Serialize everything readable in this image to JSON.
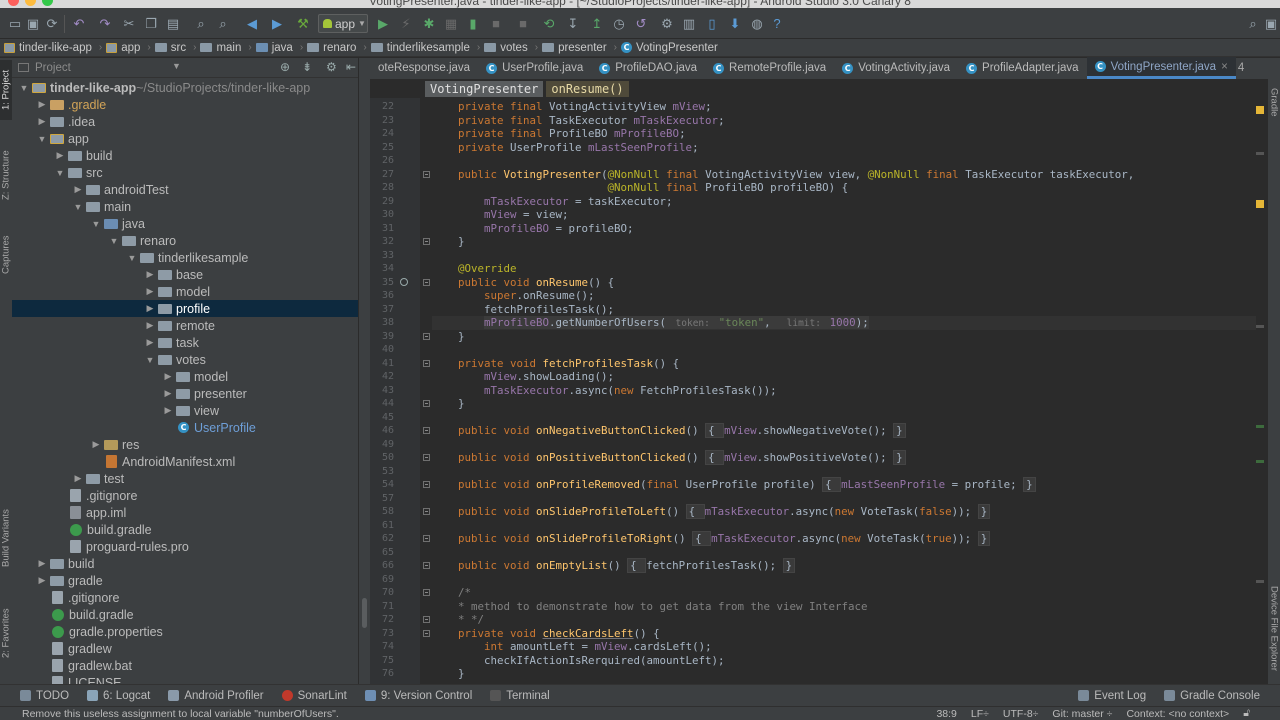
{
  "window": {
    "title": "VotingPresenter.java - tinder-like-app - [~/StudioProjects/tinder-like-app] - Android Studio 3.0 Canary 8"
  },
  "toolbar": {
    "run_config": "app"
  },
  "navbar": {
    "crumbs": [
      "tinder-like-app",
      "app",
      "src",
      "main",
      "java",
      "renaro",
      "tinderlikesample",
      "votes",
      "presenter",
      "VotingPresenter"
    ]
  },
  "left_strip": {
    "tabs": [
      "1: Project",
      "Z: Structure",
      "Captures",
      "Build Variants",
      "2: Favorites"
    ]
  },
  "right_strip": {
    "tabs": [
      "Gradle",
      "Device File Explorer"
    ]
  },
  "project": {
    "title": "Project",
    "tree": [
      {
        "label": "tinder-like-app",
        "extra": "~/StudioProjects/tinder-like-app",
        "depth": 0,
        "arrow": "down",
        "icon": "mod"
      },
      {
        "label": ".gradle",
        "depth": 1,
        "arrow": "right",
        "icon": "excluded"
      },
      {
        "label": ".idea",
        "depth": 1,
        "arrow": "right",
        "icon": "gray"
      },
      {
        "label": "app",
        "depth": 1,
        "arrow": "down",
        "icon": "mod"
      },
      {
        "label": "build",
        "depth": 2,
        "arrow": "right",
        "icon": "gray"
      },
      {
        "label": "src",
        "depth": 2,
        "arrow": "down",
        "icon": "gray"
      },
      {
        "label": "androidTest",
        "depth": 3,
        "arrow": "right",
        "icon": "gray"
      },
      {
        "label": "main",
        "depth": 3,
        "arrow": "down",
        "icon": "gray"
      },
      {
        "label": "java",
        "depth": 4,
        "arrow": "down",
        "icon": "blue"
      },
      {
        "label": "renaro",
        "depth": 5,
        "arrow": "down",
        "icon": "pkg"
      },
      {
        "label": "tinderlikesample",
        "depth": 6,
        "arrow": "down",
        "icon": "pkg"
      },
      {
        "label": "base",
        "depth": 7,
        "arrow": "right",
        "icon": "pkg"
      },
      {
        "label": "model",
        "depth": 7,
        "arrow": "right",
        "icon": "pkg"
      },
      {
        "label": "profile",
        "depth": 7,
        "arrow": "right",
        "icon": "pkg",
        "selected": true
      },
      {
        "label": "remote",
        "depth": 7,
        "arrow": "right",
        "icon": "pkg"
      },
      {
        "label": "task",
        "depth": 7,
        "arrow": "right",
        "icon": "pkg"
      },
      {
        "label": "votes",
        "depth": 7,
        "arrow": "down",
        "icon": "pkg"
      },
      {
        "label": "model",
        "depth": 8,
        "arrow": "right",
        "icon": "pkg"
      },
      {
        "label": "presenter",
        "depth": 8,
        "arrow": "right",
        "icon": "pkg"
      },
      {
        "label": "view",
        "depth": 8,
        "arrow": "right",
        "icon": "pkg"
      },
      {
        "label": "UserProfile",
        "depth": 8,
        "arrow": "",
        "icon": "class",
        "color": "#6e9fd8"
      },
      {
        "label": "res",
        "depth": 4,
        "arrow": "right",
        "icon": "res"
      },
      {
        "label": "AndroidManifest.xml",
        "depth": 4,
        "arrow": "",
        "icon": "xml"
      },
      {
        "label": "test",
        "depth": 3,
        "arrow": "right",
        "icon": "gray"
      },
      {
        "label": ".gitignore",
        "depth": 2,
        "arrow": "",
        "icon": "doc"
      },
      {
        "label": "app.iml",
        "depth": 2,
        "arrow": "",
        "icon": "iml"
      },
      {
        "label": "build.gradle",
        "depth": 2,
        "arrow": "",
        "icon": "gradle"
      },
      {
        "label": "proguard-rules.pro",
        "depth": 2,
        "arrow": "",
        "icon": "doc"
      },
      {
        "label": "build",
        "depth": 1,
        "arrow": "right",
        "icon": "gray"
      },
      {
        "label": "gradle",
        "depth": 1,
        "arrow": "right",
        "icon": "gray"
      },
      {
        "label": ".gitignore",
        "depth": 1,
        "arrow": "",
        "icon": "doc"
      },
      {
        "label": "build.gradle",
        "depth": 1,
        "arrow": "",
        "icon": "gradle"
      },
      {
        "label": "gradle.properties",
        "depth": 1,
        "arrow": "",
        "icon": "gradle"
      },
      {
        "label": "gradlew",
        "depth": 1,
        "arrow": "",
        "icon": "doc"
      },
      {
        "label": "gradlew.bat",
        "depth": 1,
        "arrow": "",
        "icon": "doc"
      },
      {
        "label": "LICENSE",
        "depth": 1,
        "arrow": "",
        "icon": "doc"
      }
    ]
  },
  "tabs": [
    {
      "label": "oteResponse.java",
      "active": false
    },
    {
      "label": "UserProfile.java",
      "active": false
    },
    {
      "label": "ProfileDAO.java",
      "active": false
    },
    {
      "label": "RemoteProfile.java",
      "active": false
    },
    {
      "label": "VotingActivity.java",
      "active": false
    },
    {
      "label": "ProfileAdapter.java",
      "active": false
    },
    {
      "label": "VotingPresenter.java",
      "active": true
    }
  ],
  "tabs_overflow": "4",
  "editor_breadcrumbs": [
    "VotingPresenter",
    "onResume()"
  ],
  "code": {
    "line_numbers": [
      "22",
      "23",
      "24",
      "25",
      "26",
      "27",
      "28",
      "29",
      "30",
      "31",
      "32",
      "33",
      "34",
      "35",
      "36",
      "37",
      "38",
      "39",
      "40",
      "41",
      "42",
      "43",
      "44",
      "45",
      "46",
      "49",
      "50",
      "53",
      "54",
      "57",
      "58",
      "61",
      "62",
      "65",
      "66",
      "69",
      "70",
      "71",
      "72",
      "73",
      "74",
      "75",
      "76"
    ]
  },
  "bottombar": {
    "items": [
      "TODO",
      "6: Logcat",
      "Android Profiler",
      "SonarLint",
      "9: Version Control",
      "Terminal"
    ],
    "right_items": [
      "Event Log",
      "Gradle Console"
    ]
  },
  "statusbar": {
    "message": "Remove this useless assignment to local variable \"numberOfUsers\".",
    "position": "38:9",
    "line_sep": "LF÷",
    "encoding": "UTF-8÷",
    "git": "Git: master ÷",
    "context": "Context: <no context>"
  }
}
